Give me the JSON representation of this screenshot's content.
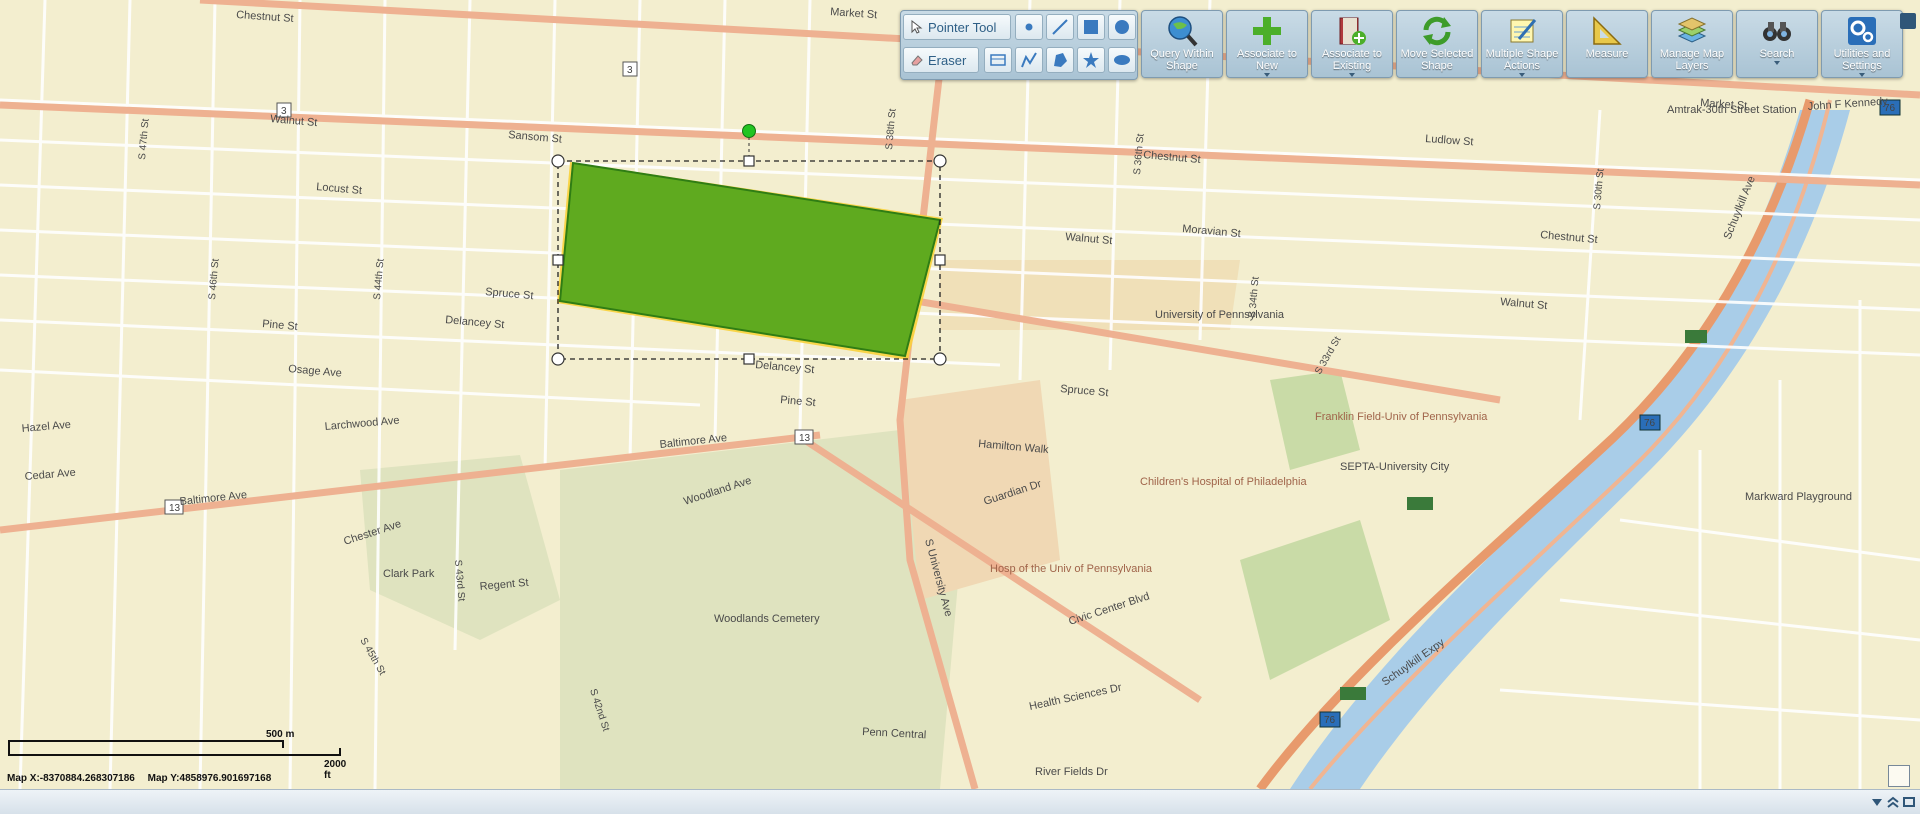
{
  "toolbar": {
    "pointer_label": "Pointer Tool",
    "eraser_label": "Eraser",
    "buttons": [
      {
        "label": "Query Within Shape",
        "icon": "globe-magnifier-icon"
      },
      {
        "label": "Associate to New",
        "icon": "plus-icon"
      },
      {
        "label": "Associate to Existing",
        "icon": "book-plus-icon"
      },
      {
        "label": "Move Selected Shape",
        "icon": "arrows-cycle-icon"
      },
      {
        "label": "Multiple Shape Actions",
        "icon": "notepad-icon"
      },
      {
        "label": "Measure",
        "icon": "ruler-triangle-icon"
      },
      {
        "label": "Manage Map Layers",
        "icon": "layers-icon"
      },
      {
        "label": "Search",
        "icon": "binoculars-icon"
      },
      {
        "label": "Utilities and Settings",
        "icon": "gears-icon"
      }
    ]
  },
  "scale": {
    "metric": "500 m",
    "imperial": "2000 ft"
  },
  "coords": {
    "x": "Map X:-8370884.268307186",
    "y": "Map Y:4858976.901697168"
  },
  "map_labels": {
    "chestnut": "Chestnut St",
    "walnut": "Walnut St",
    "sansom": "Sansom St",
    "locust": "Locust St",
    "spruce": "Spruce St",
    "pine": "Pine St",
    "delancey": "Delancey St",
    "baltimore": "Baltimore Ave",
    "woodland": "Woodland Ave",
    "market": "Market St",
    "ludlow": "Ludlow St",
    "moravian": "Moravian St",
    "clark_park": "Clark Park",
    "woodlands_cem": "Woodlands Cemetery",
    "upenn": "University of Pennsylvania",
    "franklin": "Franklin Field-Univ of Pennsylvania",
    "chop": "Children's Hospital of Philadelphia",
    "hup": "Hosp of the Univ of Pennsylvania",
    "septa": "SEPTA-University City",
    "amtrak": "Amtrak-30th Street Station",
    "schuylkill": "Schuylkill Expy",
    "hamilton": "Hamilton Walk",
    "guardian": "Guardian Dr",
    "civic": "Civic Center Blvd",
    "health": "Health Sciences Dr",
    "penn_central": "Penn Central",
    "river_fields": "River Fields Dr",
    "markward": "Markward Playground",
    "regent": "Regent St",
    "chester": "Chester Ave",
    "larchwood": "Larchwood Ave",
    "cedar": "Cedar Ave",
    "hazel": "Hazel Ave",
    "osage": "Osage Ave",
    "s42": "S 42nd St",
    "s43": "S 43rd St",
    "s44": "S 44th St",
    "s45": "S 45th St",
    "s46": "S 46th St",
    "s47": "S 47th St",
    "s38": "S 38th St",
    "s36": "S 36th St",
    "s34": "S 34th St",
    "s33": "S 33rd St",
    "s30": "S 30th St",
    "univ_ave": "S University Ave",
    "schuyl_ave": "Schuylkill Ave",
    "route13": "13",
    "route76": "76",
    "route3": "3",
    "jfk": "John F Kennedy"
  },
  "selection": {
    "state": "selected"
  }
}
